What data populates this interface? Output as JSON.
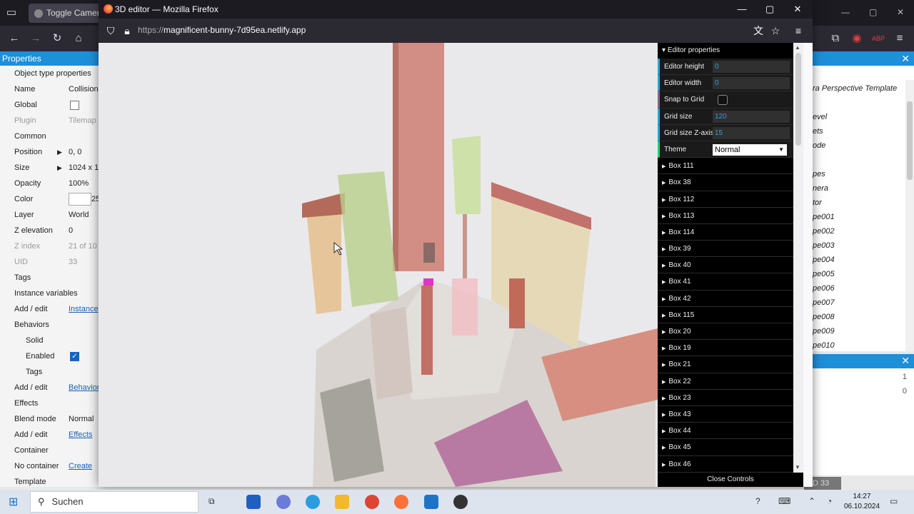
{
  "background_browser": {
    "tab_title": "Toggle Camera P"
  },
  "properties_panel": {
    "title": "Properties",
    "rows": [
      {
        "key": "Object type properties",
        "type": "section"
      },
      {
        "key": "Name",
        "value": "Collision"
      },
      {
        "key": "Global",
        "value": "",
        "checkbox": false
      },
      {
        "key": "Plugin",
        "value": "Tilemap",
        "muted": true
      },
      {
        "key": "Common",
        "type": "section"
      },
      {
        "key": "Position",
        "value": "0, 0",
        "expander": true
      },
      {
        "key": "Size",
        "value": "1024 x 1",
        "expander": true
      },
      {
        "key": "Opacity",
        "value": "100%"
      },
      {
        "key": "Color",
        "value": "25",
        "swatch": true
      },
      {
        "key": "Layer",
        "value": "World"
      },
      {
        "key": "Z elevation",
        "value": "0"
      },
      {
        "key": "Z index",
        "value": "21 of 10",
        "muted": true
      },
      {
        "key": "UID",
        "value": "33",
        "muted": true
      },
      {
        "key": "Tags",
        "value": ""
      },
      {
        "key": "Instance variables",
        "type": "section"
      },
      {
        "key": "Add / edit",
        "value": "Instance",
        "link": true
      },
      {
        "key": "Behaviors",
        "type": "section"
      },
      {
        "key": "Solid",
        "indent": true
      },
      {
        "key": "Enabled",
        "indent": true,
        "checkbox": true
      },
      {
        "key": "Tags",
        "indent": true
      },
      {
        "key": "Add / edit",
        "value": "Behavior",
        "link": true
      },
      {
        "key": "Effects",
        "type": "section"
      },
      {
        "key": "Blend mode",
        "value": "Normal"
      },
      {
        "key": "Add / edit",
        "value": "Effects",
        "link": true
      },
      {
        "key": "Container",
        "type": "section"
      },
      {
        "key": "No container",
        "value": "Create",
        "link": true
      },
      {
        "key": "Template",
        "type": "section"
      }
    ]
  },
  "project_panel": {
    "items": [
      "ra Perspective Template",
      "",
      "evel",
      "ets",
      "ode",
      "",
      "pes",
      "nera",
      "tor",
      "pe001",
      "pe002",
      "pe003",
      "pe004",
      "pe005",
      "pe006",
      "pe007",
      "pe008",
      "pe009",
      "pe010"
    ],
    "counts": [
      "1",
      "0"
    ],
    "bottom_tab": "D 33"
  },
  "firefox": {
    "window_title": "3D editor — Mozilla Firefox",
    "url_protocol": "https://",
    "url_host": "magnificent-bunny-7d95ea.netlify.app"
  },
  "controls": {
    "folder_title": "Editor properties",
    "fields": [
      {
        "label": "Editor height",
        "value": "0",
        "kind": "number"
      },
      {
        "label": "Editor width",
        "value": "0",
        "kind": "number"
      },
      {
        "label": "Snap to Grid",
        "value": "",
        "kind": "bool"
      },
      {
        "label": "Grid size",
        "value": "120",
        "kind": "number"
      },
      {
        "label": "Grid size Z-axis",
        "value": "15",
        "kind": "number"
      },
      {
        "label": "Theme",
        "value": "Normal",
        "kind": "select"
      }
    ],
    "boxes": [
      "Box 111",
      "Box 38",
      "Box 112",
      "Box 113",
      "Box 114",
      "Box 39",
      "Box 40",
      "Box 41",
      "Box 42",
      "Box 115",
      "Box 20",
      "Box 19",
      "Box 21",
      "Box 22",
      "Box 23",
      "Box 43",
      "Box 44",
      "Box 45",
      "Box 46"
    ],
    "close_label": "Close Controls"
  },
  "taskbar": {
    "search_label": "Suchen",
    "time": "14:27",
    "date": "06.10.2024"
  }
}
